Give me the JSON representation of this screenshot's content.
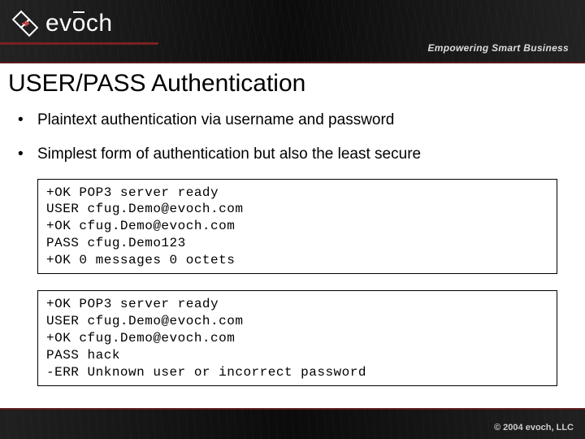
{
  "brand": {
    "name": "evōch",
    "tagline": "Empowering Smart Business"
  },
  "slide": {
    "title": "USER/PASS Authentication",
    "bullets": [
      "Plaintext authentication via username and password",
      "Simplest form of authentication but also the least secure"
    ],
    "code1": "+OK POP3 server ready\nUSER cfug.Demo@evoch.com\n+OK cfug.Demo@evoch.com\nPASS cfug.Demo123\n+OK 0 messages 0 octets",
    "code2": "+OK POP3 server ready\nUSER cfug.Demo@evoch.com\n+OK cfug.Demo@evoch.com\nPASS hack\n-ERR Unknown user or incorrect password"
  },
  "footer": {
    "copyright": "© 2004 evoch, LLC"
  }
}
